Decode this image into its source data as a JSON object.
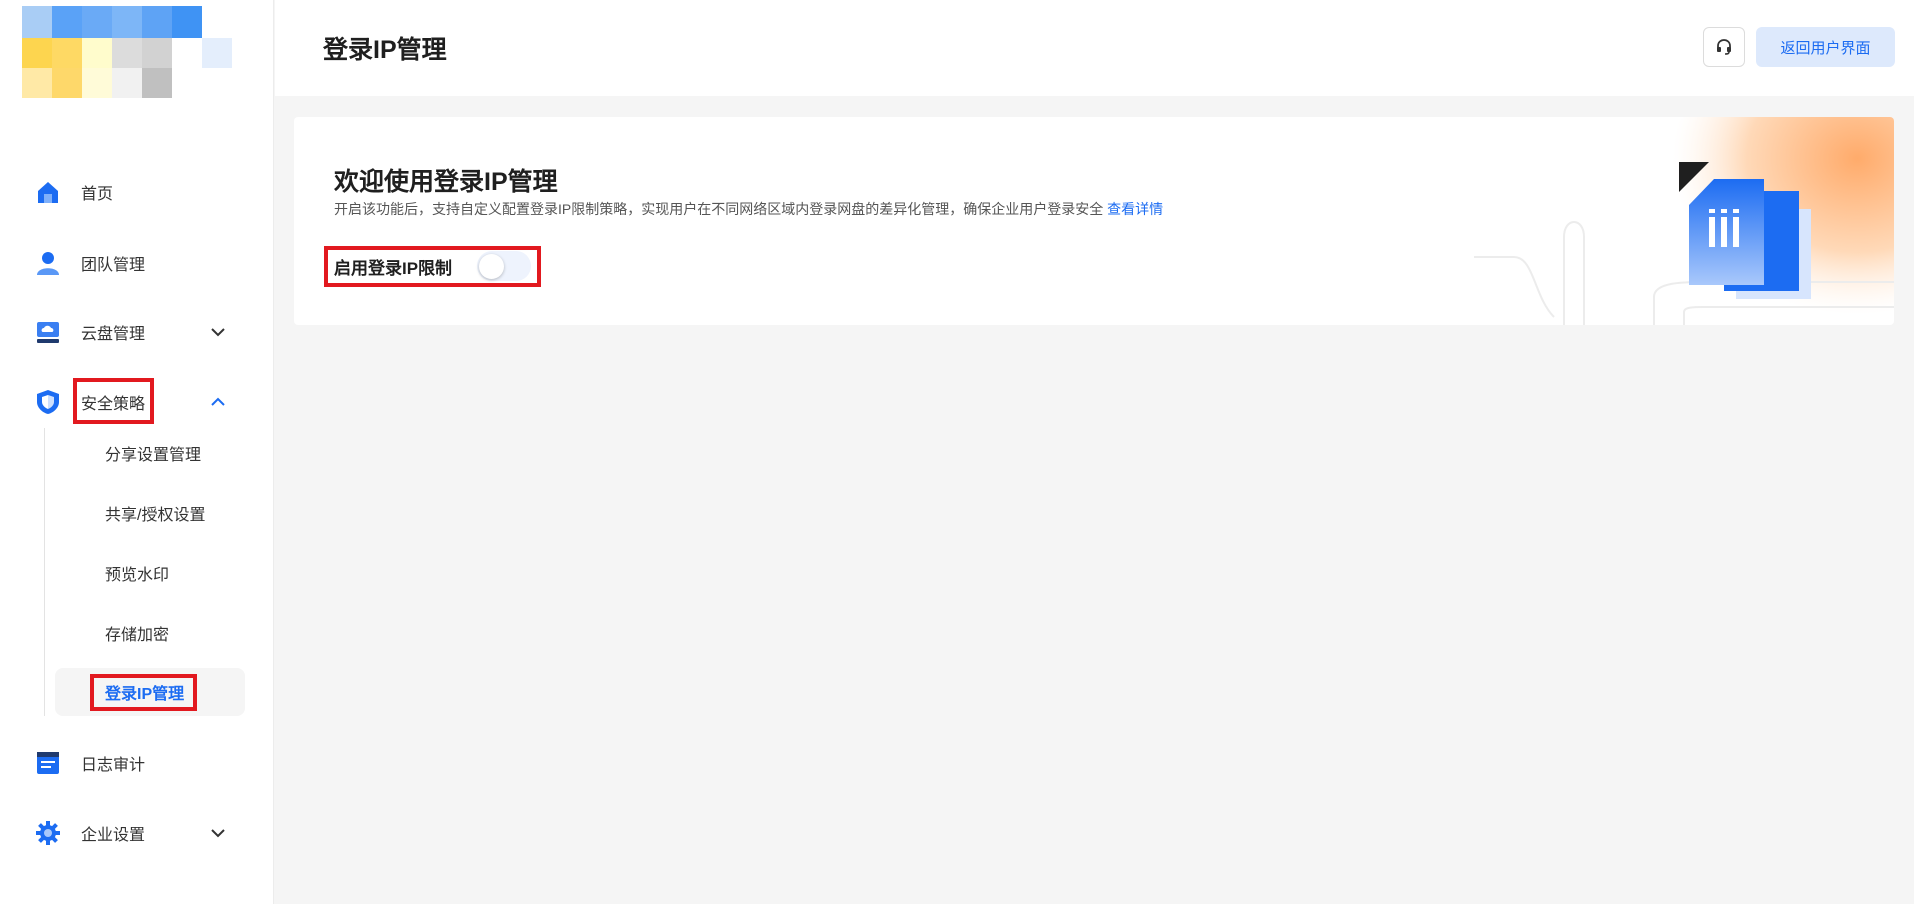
{
  "header": {
    "title": "登录IP管理",
    "support_icon": "headset-icon",
    "return_label": "返回用户界面"
  },
  "sidebar": {
    "items": [
      {
        "label": "首页",
        "icon": "home-icon"
      },
      {
        "label": "团队管理",
        "icon": "user-icon"
      },
      {
        "label": "云盘管理",
        "icon": "cloud-disk-icon",
        "expandable": true,
        "expanded": false
      },
      {
        "label": "安全策略",
        "icon": "shield-icon",
        "expandable": true,
        "expanded": true
      },
      {
        "label": "日志审计",
        "icon": "log-icon"
      },
      {
        "label": "企业设置",
        "icon": "gear-icon",
        "expandable": true,
        "expanded": false
      }
    ],
    "security_subitems": [
      {
        "label": "分享设置管理"
      },
      {
        "label": "共享/授权设置"
      },
      {
        "label": "预览水印"
      },
      {
        "label": "存储加密"
      },
      {
        "label": "登录IP管理",
        "active": true
      }
    ]
  },
  "card": {
    "title": "欢迎使用登录IP管理",
    "description": "开启该功能后，支持自定义配置登录IP限制策略，实现用户在不同网络区域内登录网盘的差异化管理，确保企业用户登录安全",
    "details_link": "查看详情",
    "toggle_label": "启用登录IP限制",
    "toggle_on": false
  },
  "colors": {
    "accent": "#1c6cf2",
    "highlight": "#e2191f",
    "illustration_orange": "#ffab6b"
  }
}
